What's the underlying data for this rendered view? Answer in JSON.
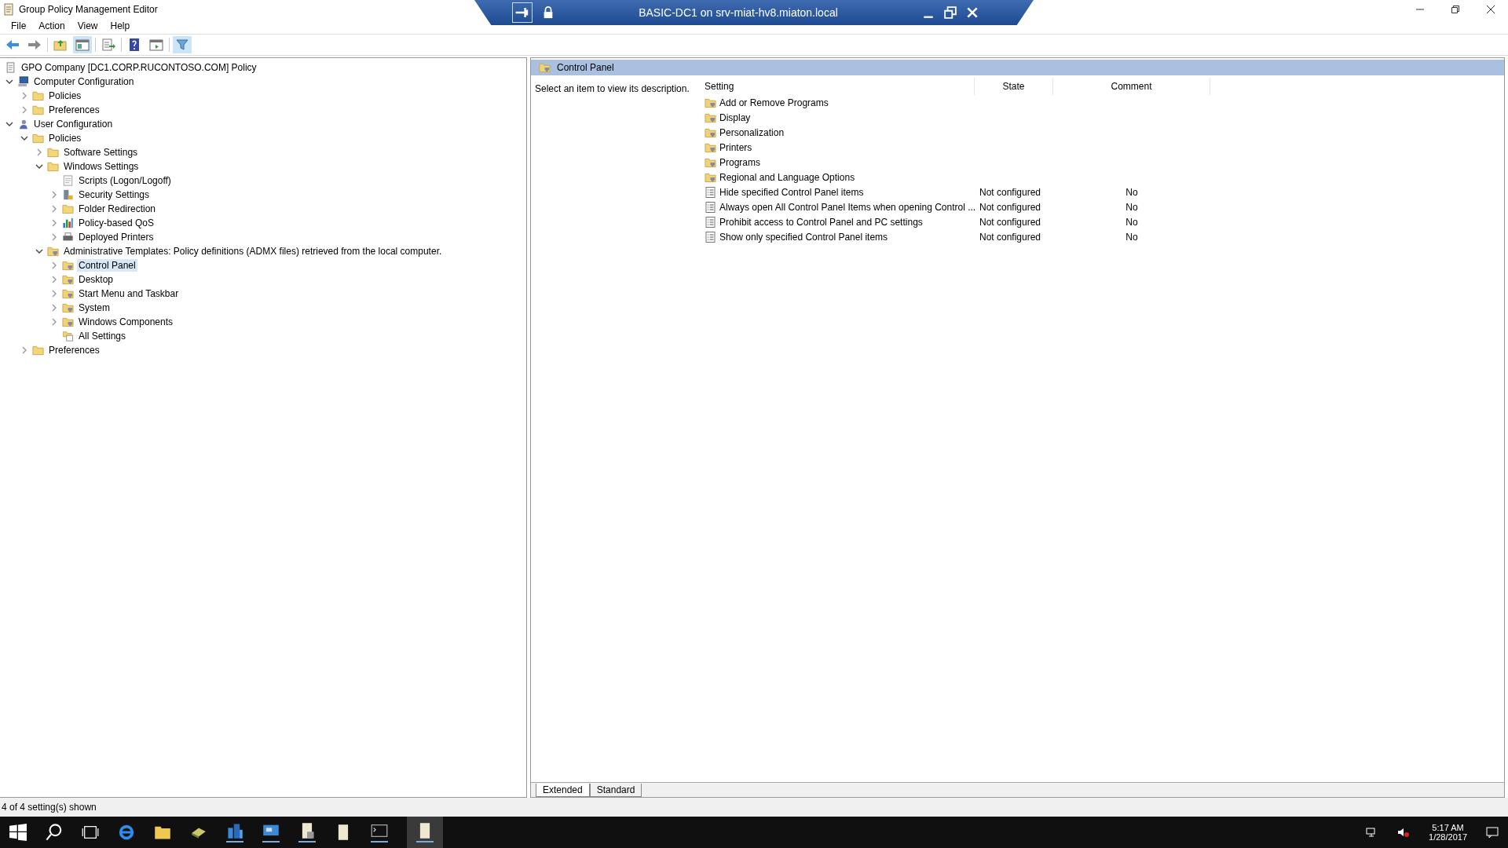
{
  "window": {
    "title": "Group Policy Management Editor"
  },
  "remote_bar": {
    "title": "BASIC-DC1 on srv-miat-hv8.miaton.local"
  },
  "menu": [
    "File",
    "Action",
    "View",
    "Help"
  ],
  "tree": {
    "label": "GPO Company [DC1.CORP.RUCONTOSO.COM] Policy",
    "children": [
      {
        "label": "Computer Configuration",
        "kind": "computer",
        "expanded": true,
        "selected": false,
        "children": [
          {
            "label": "Policies",
            "kind": "folder",
            "expanded": false,
            "selected": false
          },
          {
            "label": "Preferences",
            "kind": "folder",
            "expanded": false,
            "selected": false
          }
        ]
      },
      {
        "label": "User Configuration",
        "kind": "user",
        "expanded": true,
        "selected": false,
        "children": [
          {
            "label": "Policies",
            "kind": "folder",
            "expanded": true,
            "selected": false,
            "children": [
              {
                "label": "Software Settings",
                "kind": "folder",
                "expanded": false,
                "selected": false
              },
              {
                "label": "Windows Settings",
                "kind": "folder",
                "expanded": true,
                "selected": false,
                "children": [
                  {
                    "label": "Scripts (Logon/Logoff)",
                    "kind": "script",
                    "selected": false
                  },
                  {
                    "label": "Security Settings",
                    "kind": "security",
                    "expanded": false,
                    "selected": false
                  },
                  {
                    "label": "Folder Redirection",
                    "kind": "folder",
                    "expanded": false,
                    "selected": false
                  },
                  {
                    "label": "Policy-based QoS",
                    "kind": "qos",
                    "expanded": false,
                    "selected": false
                  },
                  {
                    "label": "Deployed Printers",
                    "kind": "printer",
                    "expanded": false,
                    "selected": false
                  }
                ]
              },
              {
                "label": "Administrative Templates: Policy definitions (ADMX files) retrieved from the local computer.",
                "kind": "policy-folder",
                "expanded": true,
                "selected": false,
                "children": [
                  {
                    "label": "Control Panel",
                    "kind": "policy-folder",
                    "expanded": false,
                    "selected": true
                  },
                  {
                    "label": "Desktop",
                    "kind": "policy-folder",
                    "expanded": false,
                    "selected": false
                  },
                  {
                    "label": "Start Menu and Taskbar",
                    "kind": "policy-folder",
                    "expanded": false,
                    "selected": false
                  },
                  {
                    "label": "System",
                    "kind": "policy-folder",
                    "expanded": false,
                    "selected": false
                  },
                  {
                    "label": "Windows Components",
                    "kind": "policy-folder",
                    "expanded": false,
                    "selected": false
                  },
                  {
                    "label": "All Settings",
                    "kind": "all-settings",
                    "selected": false
                  }
                ]
              }
            ]
          },
          {
            "label": "Preferences",
            "kind": "folder",
            "expanded": false,
            "selected": false
          }
        ]
      }
    ]
  },
  "details": {
    "heading": "Control Panel",
    "description": "Select an item to view its description.",
    "columns": [
      "Setting",
      "State",
      "Comment"
    ],
    "rows": [
      {
        "kind": "folder",
        "setting": "Add or Remove Programs"
      },
      {
        "kind": "folder",
        "setting": "Display"
      },
      {
        "kind": "folder",
        "setting": "Personalization"
      },
      {
        "kind": "folder",
        "setting": "Printers"
      },
      {
        "kind": "folder",
        "setting": "Programs"
      },
      {
        "kind": "folder",
        "setting": "Regional and Language Options"
      },
      {
        "kind": "setting",
        "setting": "Hide specified Control Panel items",
        "state": "Not configured",
        "comment": "No"
      },
      {
        "kind": "setting",
        "setting": "Always open All Control Panel Items when opening Control ...",
        "state": "Not configured",
        "comment": "No"
      },
      {
        "kind": "setting",
        "setting": "Prohibit access to Control Panel and PC settings",
        "state": "Not configured",
        "comment": "No"
      },
      {
        "kind": "setting",
        "setting": "Show only specified Control Panel items",
        "state": "Not configured",
        "comment": "No"
      }
    ],
    "tabs": [
      {
        "label": "Extended",
        "selected": true
      },
      {
        "label": "Standard",
        "selected": false
      }
    ]
  },
  "status_bar": "4 of 4 setting(s) shown",
  "clock": {
    "time": "5:17 AM",
    "date": "1/28/2017"
  }
}
